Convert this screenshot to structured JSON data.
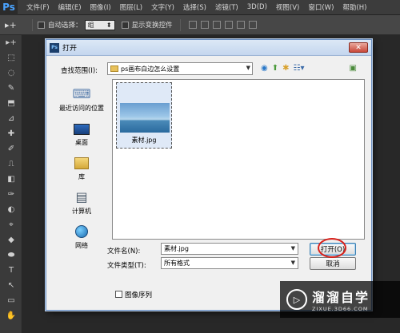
{
  "app": {
    "logo": "Ps"
  },
  "menubar": [
    "文件(F)",
    "编辑(E)",
    "图像(I)",
    "图层(L)",
    "文字(Y)",
    "选择(S)",
    "滤镜(T)",
    "3D(D)",
    "视图(V)",
    "窗口(W)",
    "帮助(H)"
  ],
  "options": {
    "move_tool": "▸+",
    "auto_select_label": "自动选择：",
    "auto_select_value": "组",
    "show_transform_label": "显示变换控件"
  },
  "toolbar": [
    "▸+",
    "⬚",
    "◌",
    "✎",
    "⬒",
    "⊿",
    "✚",
    "✐",
    "⎍",
    "◧",
    "✑",
    "◐",
    "⌖",
    "◆",
    "⬬",
    "T",
    "↖",
    "▭",
    "✋",
    "⌕"
  ],
  "dialog": {
    "title": "打开",
    "close_label": "✕",
    "lookin_label": "查找范围(I):",
    "lookin_value": "ps画布白边怎么设置",
    "places": [
      {
        "label": "最近访问的位置",
        "icon": "recent-places-icon"
      },
      {
        "label": "桌面",
        "icon": "desktop-icon"
      },
      {
        "label": "库",
        "icon": "library-icon"
      },
      {
        "label": "计算机",
        "icon": "computer-icon"
      },
      {
        "label": "网络",
        "icon": "network-icon"
      }
    ],
    "file": {
      "name": "素材.jpg"
    },
    "filename_label": "文件名(N):",
    "filename_value": "素材.jpg",
    "filetype_label": "文件类型(T):",
    "filetype_value": "所有格式",
    "open_button": "打开(O)",
    "cancel_button": "取消",
    "image_sequence_label": "图像序列"
  },
  "watermark": {
    "brand": "溜溜自学",
    "url": "ZIXUE.3D66.COM",
    "logo": "▷"
  }
}
